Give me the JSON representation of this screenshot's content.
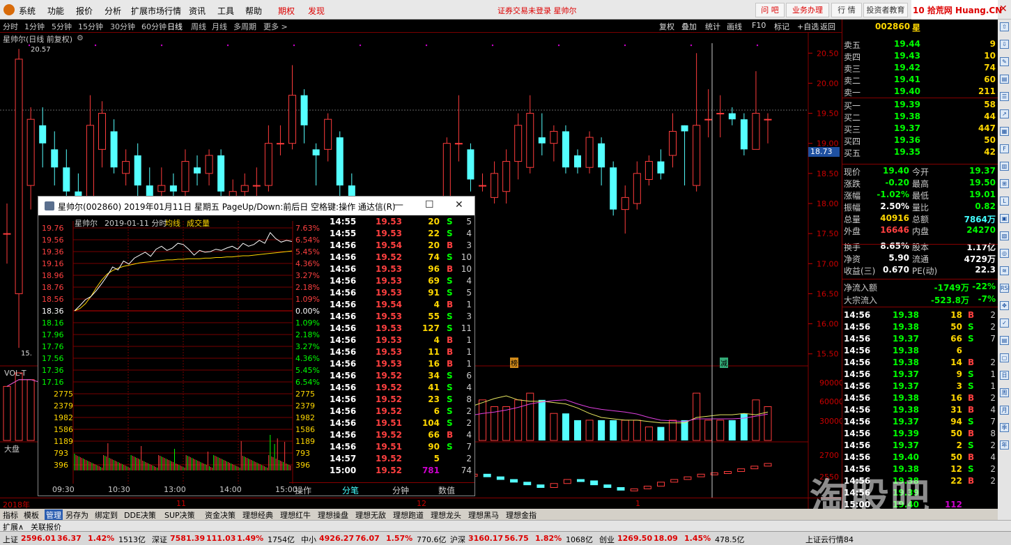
{
  "menu": {
    "items": [
      "系统",
      "功能",
      "报价",
      "分析",
      "扩展市场行情",
      "资讯",
      "工具",
      "帮助"
    ],
    "red_items": [
      "期权",
      "发现"
    ],
    "status": "证券交易未登录  星帅尔",
    "buttons": [
      "问 吧",
      "业务办理",
      "行 情",
      "投资者教育"
    ],
    "brand": "10 拾荒网 Huang.CN"
  },
  "toolbar": {
    "periods": [
      "分时",
      "1分钟",
      "5分钟",
      "15分钟",
      "30分钟",
      "60分钟",
      "日线",
      "周线",
      "月线",
      "多周期",
      "更多 >"
    ],
    "active": "日线",
    "right": [
      "复权",
      "叠加",
      "统计",
      "画线",
      "F10",
      "标记",
      "+自选",
      "返回"
    ]
  },
  "chart": {
    "title": "星帅尔(日线 前复权)",
    "max_label": "20.57",
    "min_label": "15.",
    "current_price_tag": "18.73",
    "price_axis": [
      "20.50",
      "20.00",
      "19.50",
      "19.00",
      "18.50",
      "18.00",
      "17.50",
      "17.00",
      "16.50",
      "16.00",
      "15.50"
    ],
    "vol_label": "VOL-T",
    "vol_axis": [
      "90000",
      "60000",
      "30000"
    ],
    "index_label": "大盘",
    "index_axis": [
      "2700",
      "2550"
    ],
    "date_axis": [
      "2018年",
      "11",
      "12",
      "1"
    ],
    "markers": [
      "榜",
      "减"
    ],
    "candles": [
      {
        "o": 17.5,
        "c": 17.5,
        "h": 18.0,
        "l": 17.0
      },
      {
        "o": 16.5,
        "c": 20.4,
        "h": 20.57,
        "l": 15.6
      },
      {
        "o": 18.3,
        "c": 19.4,
        "h": 19.6,
        "l": 17.9
      },
      {
        "o": 19.3,
        "c": 19.0,
        "h": 19.6,
        "l": 18.6
      },
      {
        "o": 18.9,
        "c": 18.6,
        "h": 19.2,
        "l": 18.3
      },
      {
        "o": 18.6,
        "c": 18.2,
        "h": 18.9,
        "l": 18.0
      },
      {
        "o": 18.2,
        "c": 18.1,
        "h": 18.5,
        "l": 17.9
      },
      {
        "o": 18.1,
        "c": 19.3,
        "h": 19.8,
        "l": 18.0
      },
      {
        "o": 18.9,
        "c": 19.5,
        "h": 19.7,
        "l": 18.6
      },
      {
        "o": 19.2,
        "c": 18.6,
        "h": 19.4,
        "l": 18.5
      },
      {
        "o": 18.5,
        "c": 18.7,
        "h": 18.9,
        "l": 18.3
      },
      {
        "o": 18.8,
        "c": 18.3,
        "h": 19.0,
        "l": 18.1
      },
      {
        "o": 18.3,
        "c": 18.1,
        "h": 18.6,
        "l": 18.0
      },
      {
        "o": 18.2,
        "c": 18.3,
        "h": 18.6,
        "l": 18.1
      },
      {
        "o": 18.3,
        "c": 18.2,
        "h": 18.5,
        "l": 18.0
      },
      {
        "o": 18.2,
        "c": 18.7,
        "h": 18.9,
        "l": 18.1
      },
      {
        "o": 18.6,
        "c": 18.5,
        "h": 18.8,
        "l": 18.3
      },
      {
        "o": 18.5,
        "c": 18.8,
        "h": 18.9,
        "l": 18.3
      },
      {
        "o": 18.8,
        "c": 18.2,
        "h": 18.9,
        "l": 18.0
      },
      {
        "o": 18.1,
        "c": 18.2,
        "h": 18.4,
        "l": 17.9
      },
      {
        "o": 18.2,
        "c": 18.3,
        "h": 18.5,
        "l": 18.0
      },
      {
        "o": 18.3,
        "c": 18.3,
        "h": 18.6,
        "l": 18.1
      },
      {
        "o": 18.3,
        "c": 19.0,
        "h": 19.3,
        "l": 18.2
      },
      {
        "o": 19.0,
        "c": 19.0,
        "h": 19.3,
        "l": 18.8
      },
      {
        "o": 19.0,
        "c": 19.8,
        "h": 20.3,
        "l": 18.9
      },
      {
        "o": 19.8,
        "c": 19.3,
        "h": 19.9,
        "l": 19.0
      },
      {
        "o": 18.9,
        "c": 18.8,
        "h": 19.0,
        "l": 18.3
      },
      {
        "o": 18.9,
        "c": 19.4,
        "h": 19.5,
        "l": 18.7
      },
      {
        "o": 19.1,
        "c": 18.3,
        "h": 19.2,
        "l": 18.0
      },
      {
        "o": 18.3,
        "c": 18.0,
        "h": 18.5,
        "l": 17.9
      },
      {
        "o": 17.8,
        "c": 17.9,
        "h": 18.0,
        "l": 17.5
      },
      {
        "o": 17.6,
        "c": 17.8,
        "h": 18.0,
        "l": 17.5
      },
      {
        "o": 17.3,
        "c": 17.1,
        "h": 17.5,
        "l": 17.0
      },
      {
        "o": 17.1,
        "c": 17.2,
        "h": 17.3,
        "l": 17.0
      },
      {
        "o": 17.1,
        "c": 17.2,
        "h": 17.3,
        "l": 17.0
      },
      {
        "o": 17.1,
        "c": 17.3,
        "h": 17.4,
        "l": 17.0
      },
      {
        "o": 17.2,
        "c": 17.3,
        "h": 17.5,
        "l": 17.0
      },
      {
        "o": 17.3,
        "c": 19.0,
        "h": 19.1,
        "l": 17.2
      },
      {
        "o": 19.0,
        "c": 19.0,
        "h": 19.8,
        "l": 18.7
      },
      {
        "o": 18.9,
        "c": 18.4,
        "h": 19.0,
        "l": 18.2
      },
      {
        "o": 18.3,
        "c": 18.3,
        "h": 18.5,
        "l": 18.2
      },
      {
        "o": 18.1,
        "c": 18.5,
        "h": 18.7,
        "l": 18.0
      },
      {
        "o": 18.2,
        "c": 18.7,
        "h": 18.9,
        "l": 18.0
      },
      {
        "o": 18.7,
        "c": 19.3,
        "h": 19.5,
        "l": 18.4
      },
      {
        "o": 18.6,
        "c": 19.5,
        "h": 19.8,
        "l": 18.5
      },
      {
        "o": 19.1,
        "c": 19.0,
        "h": 19.5,
        "l": 18.8
      },
      {
        "o": 19.0,
        "c": 19.2,
        "h": 19.3,
        "l": 18.7
      },
      {
        "o": 19.2,
        "c": 18.6,
        "h": 19.3,
        "l": 18.5
      },
      {
        "o": 18.8,
        "c": 18.6,
        "h": 18.9,
        "l": 18.5
      },
      {
        "o": 18.6,
        "c": 19.1,
        "h": 19.2,
        "l": 18.5
      },
      {
        "o": 19.0,
        "c": 18.6,
        "h": 19.1,
        "l": 18.3
      },
      {
        "o": 18.6,
        "c": 17.9,
        "h": 18.7,
        "l": 17.8
      },
      {
        "o": 17.9,
        "c": 18.1,
        "h": 18.3,
        "l": 17.5
      },
      {
        "o": 18.0,
        "c": 18.5,
        "h": 18.7,
        "l": 17.9
      },
      {
        "o": 18.4,
        "c": 18.7,
        "h": 18.8,
        "l": 18.3
      },
      {
        "o": 18.7,
        "c": 18.5,
        "h": 18.9,
        "l": 18.4
      },
      {
        "o": 18.8,
        "c": 19.2,
        "h": 19.5,
        "l": 18.6
      },
      {
        "o": 19.3,
        "c": 19.2,
        "h": 19.3,
        "l": 18.3
      },
      {
        "o": 18.3,
        "c": 19.3,
        "h": 20.5,
        "l": 18.2
      },
      {
        "o": 19.4,
        "c": 19.4,
        "h": 19.9,
        "l": 19.1
      },
      {
        "o": 19.5,
        "c": 19.5,
        "h": 19.8,
        "l": 19.1
      },
      {
        "o": 19.5,
        "c": 19.4,
        "h": 19.6,
        "l": 19.3
      },
      {
        "o": 19.4,
        "c": 18.9,
        "h": 19.5,
        "l": 18.8
      },
      {
        "o": 18.9,
        "c": 19.5,
        "h": 20.2,
        "l": 18.9
      },
      {
        "o": 19.4,
        "c": 19.4,
        "h": 19.5,
        "l": 19.0
      }
    ],
    "volumes": [
      8,
      10,
      9,
      7,
      6,
      5,
      6,
      7,
      9,
      6,
      5,
      4,
      4,
      3,
      3,
      3,
      3,
      3,
      4,
      3,
      4,
      3,
      5,
      6,
      7,
      6,
      5,
      5,
      4,
      4,
      3,
      3,
      2,
      2,
      2,
      3,
      2,
      3,
      9,
      8,
      6,
      5,
      5,
      6,
      7,
      6,
      4,
      4,
      3,
      3,
      3,
      3,
      3,
      3,
      2,
      2,
      3,
      3,
      7,
      3,
      3,
      3,
      4,
      6,
      5
    ],
    "index_points": [
      2620,
      2610,
      2600,
      2590,
      2580,
      2570,
      2585,
      2600,
      2595,
      2580,
      2570,
      2560,
      2565,
      2575,
      2590,
      2600,
      2610,
      2620,
      2625,
      2630,
      2640,
      2650,
      2660
    ]
  },
  "quote": {
    "code": "002860",
    "name_partial": "星",
    "sell": [
      {
        "label": "卖五",
        "price": "19.44",
        "vol": "9"
      },
      {
        "label": "卖四",
        "price": "19.43",
        "vol": "10"
      },
      {
        "label": "卖三",
        "price": "19.42",
        "vol": "74"
      },
      {
        "label": "卖二",
        "price": "19.41",
        "vol": "60"
      },
      {
        "label": "卖一",
        "price": "19.40",
        "vol": "211"
      }
    ],
    "buy": [
      {
        "label": "买一",
        "price": "19.39",
        "vol": "58"
      },
      {
        "label": "买二",
        "price": "19.38",
        "vol": "44"
      },
      {
        "label": "买三",
        "price": "19.37",
        "vol": "447"
      },
      {
        "label": "买四",
        "price": "19.36",
        "vol": "50"
      },
      {
        "label": "买五",
        "price": "19.35",
        "vol": "42"
      }
    ],
    "stats": [
      {
        "l1": "现价",
        "v1": "19.40",
        "l2": "今开",
        "v2": "19.37",
        "c1": "g",
        "c2": "g"
      },
      {
        "l1": "涨跌",
        "v1": "-0.20",
        "l2": "最高",
        "v2": "19.50",
        "c1": "g",
        "c2": "g"
      },
      {
        "l1": "涨幅",
        "v1": "-1.02%",
        "l2": "最低",
        "v2": "19.01",
        "c1": "g",
        "c2": "g"
      },
      {
        "l1": "振幅",
        "v1": "2.50%",
        "l2": "量比",
        "v2": "0.82",
        "c1": "w",
        "c2": "g"
      },
      {
        "l1": "总量",
        "v1": "40916",
        "l2": "总额",
        "v2": "7864万",
        "c1": "y",
        "c2": "c"
      },
      {
        "l1": "外盘",
        "v1": "16646",
        "l2": "内盘",
        "v2": "24270",
        "c1": "r",
        "c2": "g"
      },
      {
        "l1": "换手",
        "v1": "8.65%",
        "l2": "股本",
        "v2": "1.17亿",
        "c1": "w",
        "c2": "w"
      },
      {
        "l1": "净资",
        "v1": "5.90",
        "l2": "流通",
        "v2": "4729万",
        "c1": "w",
        "c2": "w"
      },
      {
        "l1": "收益(三)",
        "v1": "0.670",
        "l2": "PE(动)",
        "v2": "22.3",
        "c1": "w",
        "c2": "w"
      }
    ],
    "flow": [
      {
        "label": "净流入额",
        "value": "-1749万",
        "pct": "-22%"
      },
      {
        "label": "大宗流入",
        "value": "-523.8万",
        "pct": "-7%"
      }
    ],
    "ticks": [
      [
        "14:56",
        "19.38",
        "18",
        "B",
        "2"
      ],
      [
        "14:56",
        "19.38",
        "50",
        "S",
        "2"
      ],
      [
        "14:56",
        "19.37",
        "66",
        "S",
        "7"
      ],
      [
        "14:56",
        "19.38",
        "6",
        "",
        ""
      ],
      [
        "14:56",
        "19.38",
        "14",
        "B",
        "2"
      ],
      [
        "14:56",
        "19.37",
        "9",
        "S",
        "1"
      ],
      [
        "14:56",
        "19.37",
        "3",
        "S",
        "1"
      ],
      [
        "14:56",
        "19.38",
        "16",
        "B",
        "2"
      ],
      [
        "14:56",
        "19.38",
        "31",
        "B",
        "4"
      ],
      [
        "14:56",
        "19.37",
        "94",
        "S",
        "7"
      ],
      [
        "14:56",
        "19.39",
        "50",
        "B",
        "8"
      ],
      [
        "14:56",
        "19.37",
        "2",
        "S",
        "2"
      ],
      [
        "14:56",
        "19.40",
        "50",
        "B",
        "4"
      ],
      [
        "14:56",
        "19.38",
        "12",
        "S",
        "2"
      ],
      [
        "14:56",
        "19.38",
        "22",
        "B",
        "2"
      ],
      [
        "14:56",
        "19.39",
        "",
        "",
        ""
      ],
      [
        "15:00",
        "19.40",
        "112",
        "",
        ""
      ]
    ]
  },
  "popup": {
    "title": "星帅尔(002860) 2019年01月11日 星期五 PageUp/Down:前后日 空格键:操作 通达信(R)",
    "subtitle_name": "星帅尔",
    "subtitle_date": "2019-01-11 分时",
    "legend_avg": "均线",
    "legend_vol": "成交量",
    "price_ticks": [
      "19.76",
      "19.56",
      "19.36",
      "19.16",
      "18.96",
      "18.76",
      "18.56",
      "18.36",
      "18.16",
      "17.96",
      "17.76",
      "17.56",
      "17.36",
      "17.16"
    ],
    "pct_ticks": [
      "7.63%",
      "6.54%",
      "5.45%",
      "4.36%",
      "3.27%",
      "2.18%",
      "1.09%",
      "0.00%",
      "1.09%",
      "2.18%",
      "3.27%",
      "4.36%",
      "5.45%",
      "6.54%"
    ],
    "vol_ticks": [
      "2775",
      "2379",
      "1982",
      "1586",
      "1189",
      "793",
      "396"
    ],
    "time_ticks": [
      "09:30",
      "10:30",
      "13:00",
      "14:00",
      "15:00"
    ],
    "tabs": [
      "操作",
      "分笔",
      "分钟",
      "数值"
    ],
    "active_tab": "分笔",
    "ticks": [
      [
        "14:55",
        "19.53",
        "20",
        "S",
        "5"
      ],
      [
        "14:55",
        "19.53",
        "22",
        "S",
        "4"
      ],
      [
        "14:56",
        "19.54",
        "20",
        "B",
        "3"
      ],
      [
        "14:56",
        "19.52",
        "74",
        "S",
        "10"
      ],
      [
        "14:56",
        "19.53",
        "96",
        "B",
        "10"
      ],
      [
        "14:56",
        "19.53",
        "69",
        "S",
        "4"
      ],
      [
        "14:56",
        "19.53",
        "91",
        "S",
        "5"
      ],
      [
        "14:56",
        "19.54",
        "4",
        "B",
        "1"
      ],
      [
        "14:56",
        "19.53",
        "55",
        "S",
        "3"
      ],
      [
        "14:56",
        "19.53",
        "127",
        "S",
        "11"
      ],
      [
        "14:56",
        "19.53",
        "4",
        "B",
        "1"
      ],
      [
        "14:56",
        "19.53",
        "11",
        "B",
        "1"
      ],
      [
        "14:56",
        "19.53",
        "16",
        "B",
        "1"
      ],
      [
        "14:56",
        "19.52",
        "34",
        "S",
        "6"
      ],
      [
        "14:56",
        "19.52",
        "41",
        "S",
        "4"
      ],
      [
        "14:56",
        "19.52",
        "23",
        "S",
        "8"
      ],
      [
        "14:56",
        "19.52",
        "6",
        "S",
        "2"
      ],
      [
        "14:56",
        "19.51",
        "104",
        "S",
        "2"
      ],
      [
        "14:56",
        "19.52",
        "66",
        "B",
        "4"
      ],
      [
        "14:56",
        "19.51",
        "90",
        "S",
        "7"
      ],
      [
        "14:57",
        "19.52",
        "5",
        "",
        "2"
      ],
      [
        "15:00",
        "19.52",
        "781",
        "",
        "74"
      ]
    ],
    "price_line": [
      18.36,
      18.45,
      18.55,
      18.6,
      18.7,
      18.82,
      18.95,
      19.1,
      19.05,
      19.2,
      19.15,
      19.25,
      19.3,
      19.35,
      19.28,
      19.4,
      19.45,
      19.38,
      19.42,
      19.5,
      19.48,
      19.4,
      19.3,
      19.38,
      19.35,
      19.36,
      19.4,
      19.38,
      19.42,
      19.45,
      19.4,
      19.5,
      19.45,
      19.48,
      19.55,
      19.5,
      19.68,
      19.58,
      19.52,
      19.55,
      19.53
    ],
    "avg_line": [
      18.36,
      18.4,
      18.48,
      18.6,
      18.75,
      18.88,
      18.98,
      19.04,
      19.08,
      19.11,
      19.13,
      19.15,
      19.17,
      19.18,
      19.19,
      19.2,
      19.21,
      19.22,
      19.22,
      19.23,
      19.23,
      19.24,
      19.24,
      19.24,
      19.25,
      19.25,
      19.26,
      19.26,
      19.27,
      19.27,
      19.28,
      19.29,
      19.29,
      19.3,
      19.31,
      19.32,
      19.33,
      19.34,
      19.35,
      19.36,
      19.37
    ]
  },
  "bottom": {
    "tabs": [
      "指标",
      "模板",
      "管理",
      "另存为",
      "绑定到",
      "DDE决策",
      "SUP决策",
      "资金决策",
      "理想经典",
      "理想红牛",
      "理想操盘",
      "理想无敌",
      "理想跑道",
      "理想龙头",
      "理想黑马",
      "理想金指"
    ],
    "active": "管理",
    "ext": [
      "扩展∧",
      "关联报价"
    ]
  },
  "ticker": [
    {
      "name": "上证",
      "value": "2596.01",
      "chg": "36.37",
      "pct": "1.42%",
      "amt": "1513亿"
    },
    {
      "name": "深证",
      "value": "7581.39",
      "chg": "111.03",
      "pct": "1.49%",
      "amt": "1754亿"
    },
    {
      "name": "中小",
      "value": "4926.27",
      "chg": "76.07",
      "pct": "1.57%",
      "amt": "770.6亿"
    },
    {
      "name": "沪深",
      "value": "3160.17",
      "chg": "56.75",
      "pct": "1.82%",
      "amt": "1068亿"
    },
    {
      "name": "创业",
      "value": "1269.50",
      "chg": "18.09",
      "pct": "1.45%",
      "amt": "478.5亿"
    }
  ],
  "ticker_right": "上证云行情84",
  "watermark": "淘股吧",
  "watermark_tabs": [
    "笔",
    "价",
    "细",
    "势",
    "值",
    "主",
    "关"
  ]
}
